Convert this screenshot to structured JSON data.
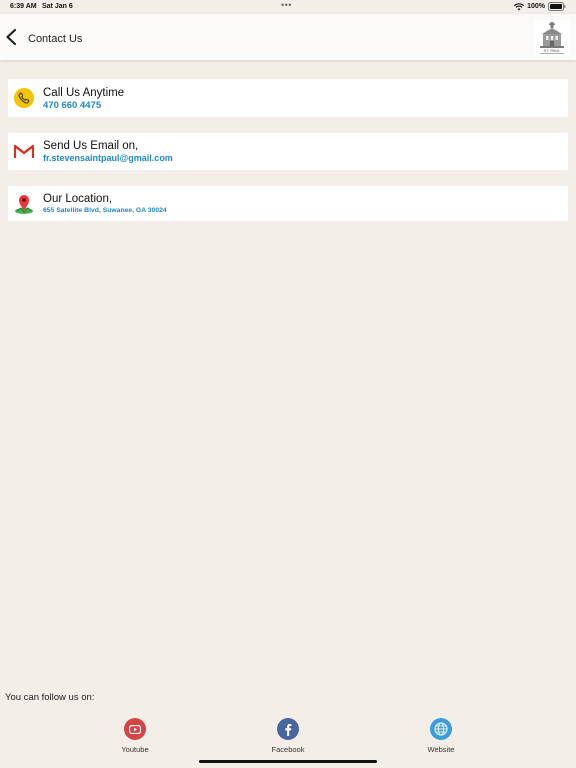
{
  "status_bar": {
    "time": "6:39 AM",
    "date": "Sat Jan 6",
    "dots": "•••",
    "battery": "100%",
    "icons": [
      "wifi-icon",
      "battery-icon"
    ]
  },
  "header": {
    "title": "Contact Us",
    "back_icon": "chevron-left-icon",
    "logo_text": "ST. PAUL"
  },
  "contacts": [
    {
      "title": "Call Us Anytime",
      "value": "470 660 4475",
      "icon": "phone-icon",
      "icon_color": "#f5c400"
    },
    {
      "title": "Send Us Email on,",
      "value": "fr.stevensaintpaul@gmail.com",
      "icon": "gmail-icon",
      "icon_color": "#d93025"
    },
    {
      "title": "Our Location,",
      "value": "655 Satellite Blvd, Suwanee, GA 30024",
      "icon": "map-pin-icon",
      "icon_color": "#e53935"
    }
  ],
  "follow": {
    "label": "You can follow us on:",
    "items": [
      {
        "label": "Youtube",
        "icon": "youtube-icon",
        "color": "#d64545"
      },
      {
        "label": "Facebook",
        "icon": "facebook-icon",
        "color": "#4a66a0"
      },
      {
        "label": "Website",
        "icon": "globe-icon",
        "color": "#3b9ddd"
      }
    ]
  },
  "colors": {
    "background": "#f3eee8",
    "card": "#ffffff",
    "link": "#1e88c7"
  }
}
